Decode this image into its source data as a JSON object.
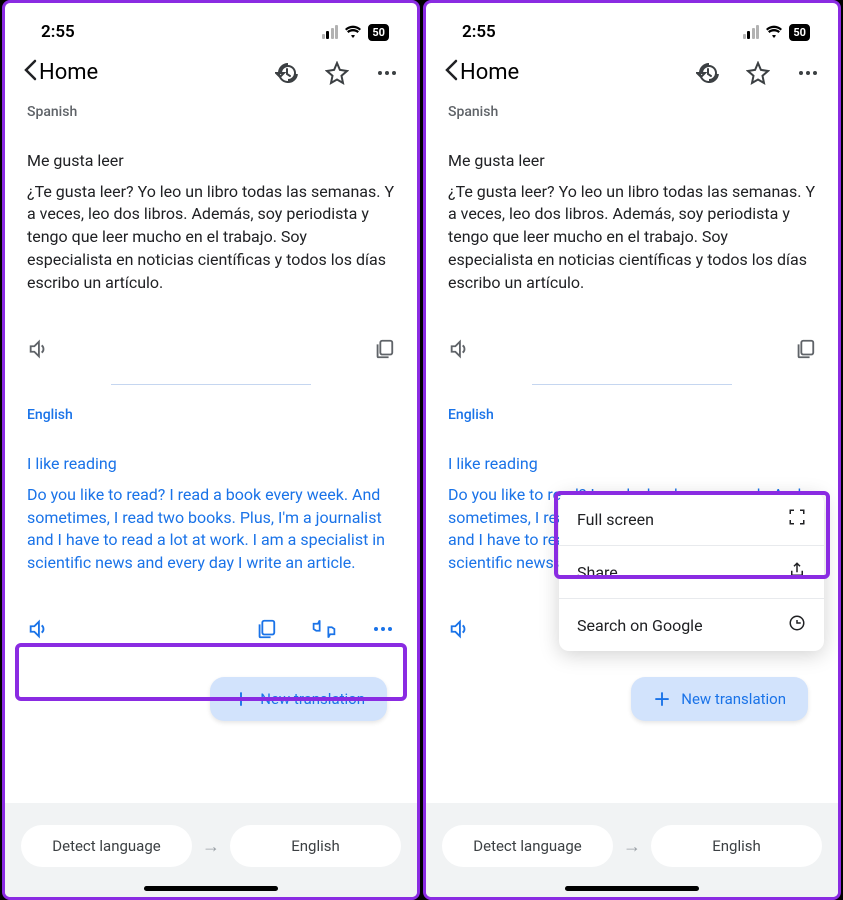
{
  "status": {
    "time": "2:55",
    "battery": "50"
  },
  "header": {
    "home": "Home"
  },
  "source": {
    "lang": "Spanish",
    "line1": "Me gusta leer",
    "para": "¿Te gusta leer? Yo leo un libro todas las semanas. Y a veces, leo dos libros. Además, soy periodista y tengo que leer mucho en el trabajo. Soy especialista en noticias científicas y todos los días escribo un artículo."
  },
  "target": {
    "lang": "English",
    "line1": "I like reading",
    "para": "Do you like to read? I read a book every week. And sometimes, I read two books. Plus, I'm a journalist and I have to read a lot at work. I am a specialist in scientific news and every day I write an article."
  },
  "new_translation": "New translation",
  "bottom": {
    "detect": "Detect language",
    "target": "English"
  },
  "menu": {
    "fullscreen": "Full screen",
    "share": "Share",
    "search": "Search on Google"
  }
}
